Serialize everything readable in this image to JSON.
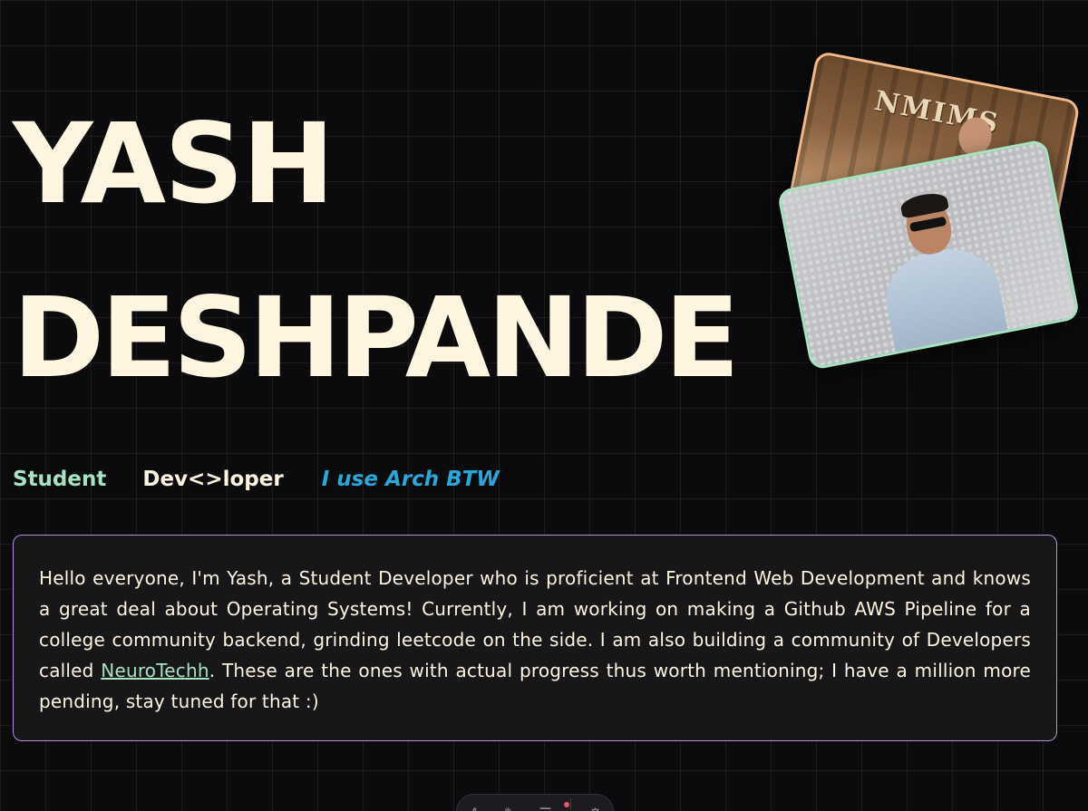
{
  "hero": {
    "first_name": "YASH",
    "last_name": "DESHPANDE"
  },
  "photos": {
    "back_sign_text": "NMIMS"
  },
  "tags": [
    {
      "label": "Student",
      "color": "#a7e2c1"
    },
    {
      "label": "Dev<>loper",
      "color": "#fff5e0"
    },
    {
      "label": "I use Arch BTW",
      "color": "#2aa7d8"
    }
  ],
  "about": {
    "text_before_link": "Hello everyone, I'm Yash, a Student Developer who is proficient at Frontend Web Development and knows a great deal about Operating Systems! Currently, I am working on making a Github AWS Pipeline for a college community backend, grinding leetcode on the side. I am also building a community of Developers called ",
    "link_label": "NeuroTechh",
    "text_after_link": ". These are the ones with actual progress thus worth mentioning; I have a million more pending, stay tuned for that :)"
  },
  "dock": {
    "items": [
      {
        "icon": "home-icon",
        "glyph": "A"
      },
      {
        "icon": "projects-icon",
        "glyph": "✎"
      },
      {
        "icon": "menu-icon",
        "glyph": "☰"
      },
      {
        "icon": "settings-icon",
        "glyph": "⚙"
      }
    ]
  },
  "colors": {
    "background": "#0b0b0d",
    "text": "#fff5e0",
    "accent_mint": "#a7e2c1",
    "accent_blue": "#2aa7d8",
    "card_border": "#b58fe0",
    "photo_border_back": "#f2b98a",
    "photo_border_front": "#a7e2c1"
  }
}
